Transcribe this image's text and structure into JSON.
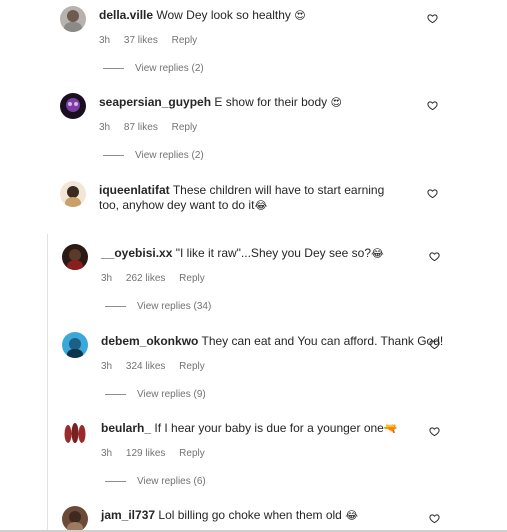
{
  "comments": [
    {
      "username": "della.ville",
      "text": "Wow Dey look so healthy",
      "emoji": "😍",
      "time": "3h",
      "likes": "37 likes",
      "reply": "Reply",
      "view_replies": "View replies (2)"
    },
    {
      "username": "seapersian_guypeh",
      "text": "E show for their body",
      "emoji": "😍",
      "time": "3h",
      "likes": "87 likes",
      "reply": "Reply",
      "view_replies": "View replies (2)"
    },
    {
      "username": "iqueenlatifat",
      "text": "These children will have to start earning too, anyhow dey want to do it",
      "emoji": "😂",
      "time": "",
      "likes": "",
      "reply": "",
      "view_replies": ""
    },
    {
      "username": "__oyebisi.xx",
      "text": "\"I like it raw\"...Shey you Dey see so?",
      "emoji": "😂",
      "time": "3h",
      "likes": "262 likes",
      "reply": "Reply",
      "view_replies": "View replies (34)"
    },
    {
      "username": "debem_okonkwo",
      "text": "They can eat and You can afford. Thank God!",
      "emoji": "",
      "time": "3h",
      "likes": "324 likes",
      "reply": "Reply",
      "view_replies": "View replies (9)"
    },
    {
      "username": "beularh_",
      "text": " If I hear your baby is due for a younger one",
      "emoji": "🔫",
      "time": "3h",
      "likes": "129 likes",
      "reply": "Reply",
      "view_replies": "View replies (6)"
    },
    {
      "username": "jam_il737",
      "text": "Lol billing go choke when them old",
      "emoji": "😂",
      "time": "",
      "likes": "",
      "reply": "",
      "view_replies": ""
    }
  ],
  "icons": {
    "like": "heart-outline-icon"
  },
  "colors": {
    "username": "#262626",
    "meta": "#737373",
    "heart_stroke": "#262626"
  }
}
